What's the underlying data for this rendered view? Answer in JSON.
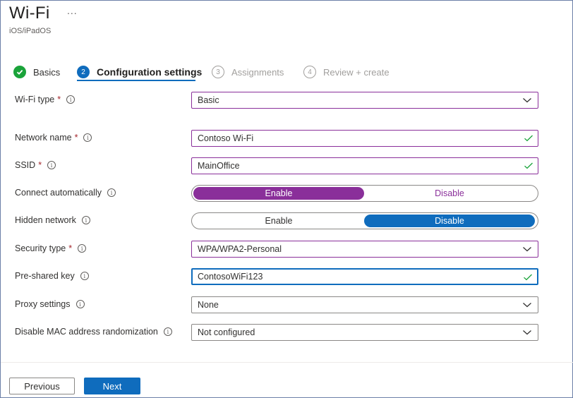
{
  "header": {
    "title": "Wi-Fi",
    "more_label": "...",
    "subtitle": "iOS/iPadOS"
  },
  "steps": [
    {
      "number": "✓",
      "label": "Basics",
      "state": "done"
    },
    {
      "number": "2",
      "label": "Configuration settings",
      "state": "active"
    },
    {
      "number": "3",
      "label": "Assignments",
      "state": "todo"
    },
    {
      "number": "4",
      "label": "Review + create",
      "state": "todo"
    }
  ],
  "form": {
    "wifi_type": {
      "label": "Wi-Fi type",
      "required": "*",
      "value": "Basic"
    },
    "network_name": {
      "label": "Network name",
      "required": "*",
      "value": "Contoso Wi-Fi"
    },
    "ssid": {
      "label": "SSID",
      "required": "*",
      "value": "MainOffice"
    },
    "connect_automatically": {
      "label": "Connect automatically",
      "enable": "Enable",
      "disable": "Disable",
      "selected": "Enable"
    },
    "hidden_network": {
      "label": "Hidden network",
      "enable": "Enable",
      "disable": "Disable",
      "selected": "Disable"
    },
    "security_type": {
      "label": "Security type",
      "required": "*",
      "value": "WPA/WPA2-Personal"
    },
    "pre_shared_key": {
      "label": "Pre-shared key",
      "value": "ContosoWiFi123"
    },
    "proxy_settings": {
      "label": "Proxy settings",
      "value": "None"
    },
    "mac_randomization": {
      "label": "Disable MAC address randomization",
      "value": "Not configured"
    }
  },
  "footer": {
    "previous_label": "Previous",
    "next_label": "Next"
  },
  "colors": {
    "accent": "#0f6cbd",
    "purple": "#8a2f9a",
    "success": "#1aa33a",
    "required": "#a4262c"
  }
}
